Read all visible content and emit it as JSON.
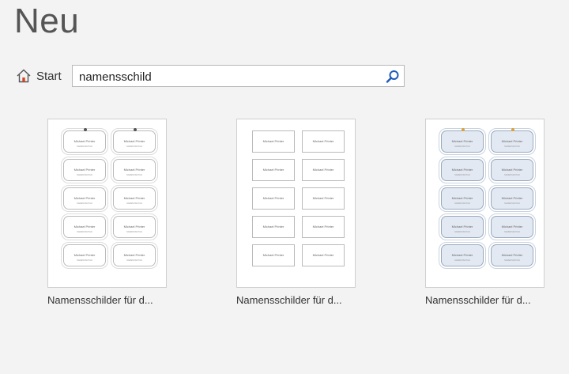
{
  "header": {
    "title": "Neu"
  },
  "nav": {
    "start_label": "Start",
    "home_icon": "home-icon"
  },
  "search": {
    "value": "namensschild",
    "icon": "search-icon"
  },
  "colors": {
    "accent": "#1e5bb8",
    "home_icon": "#d24726"
  },
  "templates": [
    {
      "label": "Namensschilder für d...",
      "style": "ornate",
      "card_name": "Michael Printer",
      "card_sub": "NAMENSSCHILD"
    },
    {
      "label": "Namensschilder für d...",
      "style": "plain",
      "card_name": "Michael Printer",
      "card_sub": ""
    },
    {
      "label": "Namensschilder für d...",
      "style": "ornate-blue",
      "card_name": "Michael Printer",
      "card_sub": "NAMENSSCHILD"
    }
  ]
}
